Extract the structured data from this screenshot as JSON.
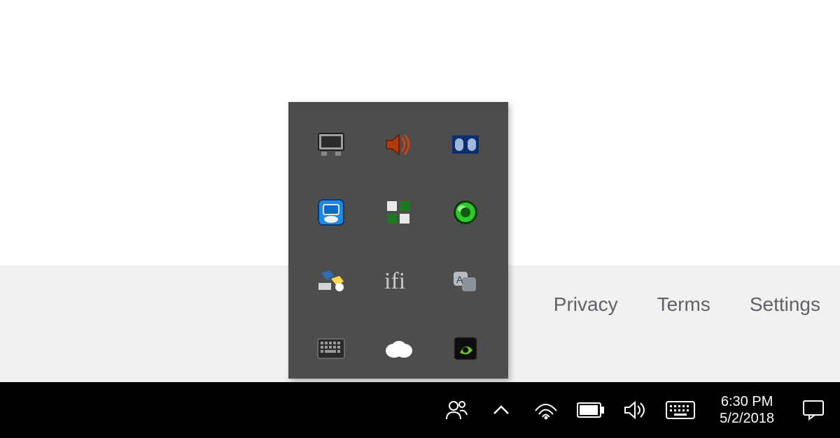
{
  "footer": {
    "privacy": "Privacy",
    "terms": "Terms",
    "settings": "Settings"
  },
  "tray_popup": {
    "icons": [
      "display-settings-icon",
      "realtek-audio-icon",
      "dolby-audio-icon",
      "intel-graphics-icon",
      "security-shield-icon",
      "nvidia-geforce-icon",
      "devices-icon",
      "ifi-audio-icon",
      "translate-icon",
      "keyboard-icon",
      "onedrive-icon",
      "nvidia-settings-icon"
    ]
  },
  "system_tray": {
    "people_icon": "people-icon",
    "overflow_icon": "tray-overflow-chevron-icon",
    "wifi_icon": "wifi-icon",
    "battery_icon": "battery-icon",
    "volume_icon": "volume-icon",
    "ime_icon": "input-method-keyboard-icon",
    "action_center_icon": "action-center-icon"
  },
  "clock": {
    "time": "6:30 PM",
    "date": "5/2/2018"
  }
}
